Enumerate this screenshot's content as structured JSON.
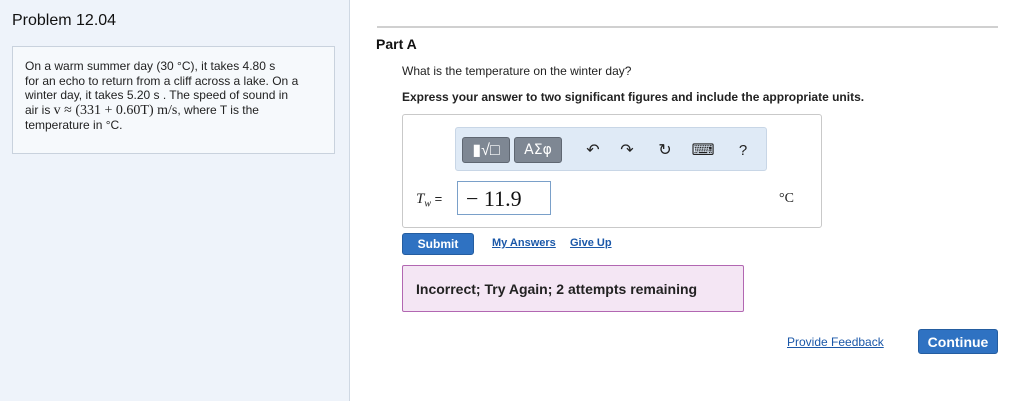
{
  "problem": {
    "title": "Problem 12.04",
    "text_line1": "On a warm summer day (30 °C), it takes 4.80 s",
    "text_line2": "for an echo to return from a cliff across a lake. On a",
    "text_line3": "winter day, it takes 5.20 s . The speed of sound in",
    "text_line4_pre": "air is ",
    "text_line4_math": "v ≈ (331 + 0.60T) m/s",
    "text_line4_post": ", where T is the",
    "text_line5": "temperature in °C."
  },
  "part": {
    "title": "Part A",
    "question": "What is the temperature on the winter day?",
    "instruction": "Express your answer to two significant figures and include the appropriate units."
  },
  "toolbar": {
    "templates_label": "▮√□",
    "greek_label": "ΑΣφ",
    "undo_icon": "↶",
    "redo_icon": "↷",
    "reset_icon": "↻",
    "keyboard_icon": "⌨",
    "help_label": "?"
  },
  "answer": {
    "variable_symbol": "T",
    "variable_subscript": "w",
    "equals": "=",
    "value": "− 11.9",
    "unit": "°C"
  },
  "actions": {
    "submit_label": "Submit",
    "my_answers_label": "My Answers",
    "give_up_label": "Give Up"
  },
  "feedback": {
    "message": "Incorrect; Try Again; 2 attempts remaining"
  },
  "footer": {
    "provide_feedback_label": "Provide Feedback",
    "continue_label": "Continue"
  },
  "colors": {
    "accent": "#2f72c2",
    "incorrect_border": "#b267b2",
    "incorrect_bg": "#f4e6f4",
    "panel_bg": "#eef3fa"
  }
}
